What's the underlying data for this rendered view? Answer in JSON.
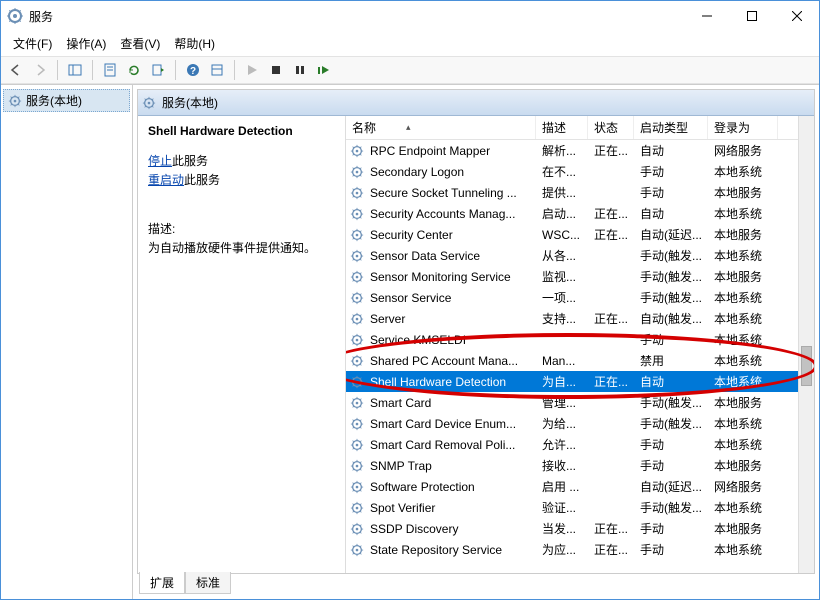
{
  "window": {
    "title": "服务"
  },
  "menu": {
    "file": "文件(F)",
    "action": "操作(A)",
    "view": "查看(V)",
    "help": "帮助(H)"
  },
  "tree": {
    "root": "服务(本地)"
  },
  "listHeader": {
    "title": "服务(本地)"
  },
  "detail": {
    "selectedName": "Shell Hardware Detection",
    "stopLink": "停止",
    "stopSuffix": "此服务",
    "restartLink": "重启动",
    "restartSuffix": "此服务",
    "descLabel": "描述:",
    "descText": "为自动播放硬件事件提供通知。"
  },
  "columns": {
    "name": "名称",
    "desc": "描述",
    "status": "状态",
    "startup": "启动类型",
    "logon": "登录为"
  },
  "tabs": {
    "extended": "扩展",
    "standard": "标准"
  },
  "rows": [
    {
      "name": "RPC Endpoint Mapper",
      "desc": "解析...",
      "status": "正在...",
      "startup": "自动",
      "logon": "网络服务"
    },
    {
      "name": "Secondary Logon",
      "desc": "在不...",
      "status": "",
      "startup": "手动",
      "logon": "本地系统"
    },
    {
      "name": "Secure Socket Tunneling ...",
      "desc": "提供...",
      "status": "",
      "startup": "手动",
      "logon": "本地服务"
    },
    {
      "name": "Security Accounts Manag...",
      "desc": "启动...",
      "status": "正在...",
      "startup": "自动",
      "logon": "本地系统"
    },
    {
      "name": "Security Center",
      "desc": "WSC...",
      "status": "正在...",
      "startup": "自动(延迟...",
      "logon": "本地服务"
    },
    {
      "name": "Sensor Data Service",
      "desc": "从各...",
      "status": "",
      "startup": "手动(触发...",
      "logon": "本地系统"
    },
    {
      "name": "Sensor Monitoring Service",
      "desc": "监视...",
      "status": "",
      "startup": "手动(触发...",
      "logon": "本地服务"
    },
    {
      "name": "Sensor Service",
      "desc": "一项...",
      "status": "",
      "startup": "手动(触发...",
      "logon": "本地系统"
    },
    {
      "name": "Server",
      "desc": "支持...",
      "status": "正在...",
      "startup": "自动(触发...",
      "logon": "本地系统"
    },
    {
      "name": "Service KMSELDI",
      "desc": "",
      "status": "",
      "startup": "手动",
      "logon": "本地系统"
    },
    {
      "name": "Shared PC Account Mana...",
      "desc": "Man...",
      "status": "",
      "startup": "禁用",
      "logon": "本地系统"
    },
    {
      "name": "Shell Hardware Detection",
      "desc": "为自...",
      "status": "正在...",
      "startup": "自动",
      "logon": "本地系统",
      "selected": true
    },
    {
      "name": "Smart Card",
      "desc": "管理...",
      "status": "",
      "startup": "手动(触发...",
      "logon": "本地服务"
    },
    {
      "name": "Smart Card Device Enum...",
      "desc": "为给...",
      "status": "",
      "startup": "手动(触发...",
      "logon": "本地系统"
    },
    {
      "name": "Smart Card Removal Poli...",
      "desc": "允许...",
      "status": "",
      "startup": "手动",
      "logon": "本地系统"
    },
    {
      "name": "SNMP Trap",
      "desc": "接收...",
      "status": "",
      "startup": "手动",
      "logon": "本地服务"
    },
    {
      "name": "Software Protection",
      "desc": "启用 ...",
      "status": "",
      "startup": "自动(延迟...",
      "logon": "网络服务"
    },
    {
      "name": "Spot Verifier",
      "desc": "验证...",
      "status": "",
      "startup": "手动(触发...",
      "logon": "本地系统"
    },
    {
      "name": "SSDP Discovery",
      "desc": "当发...",
      "status": "正在...",
      "startup": "手动",
      "logon": "本地服务"
    },
    {
      "name": "State Repository Service",
      "desc": "为应...",
      "status": "正在...",
      "startup": "手动",
      "logon": "本地系统"
    }
  ]
}
